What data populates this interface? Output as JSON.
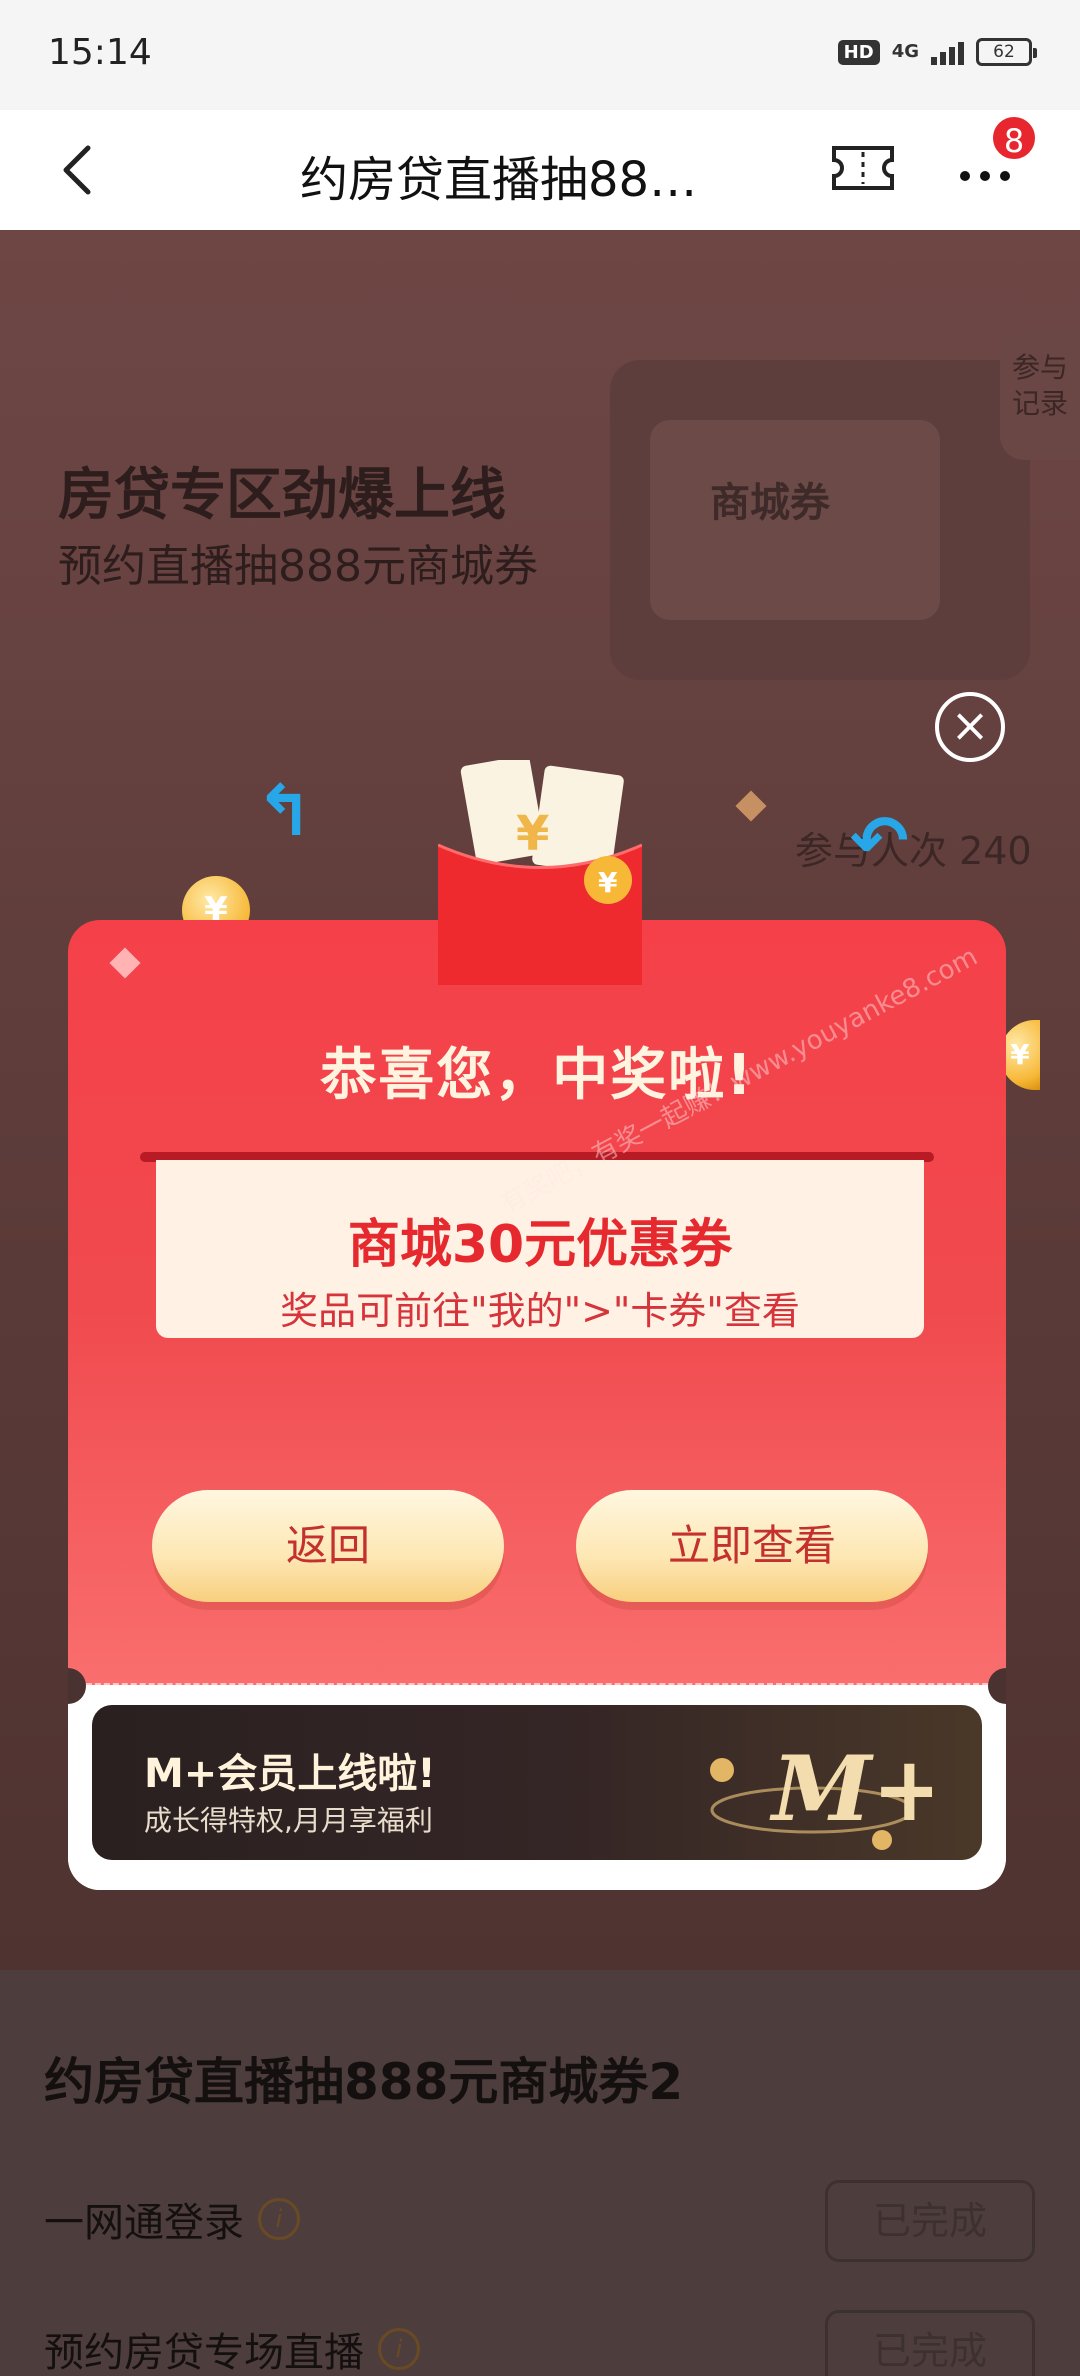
{
  "status_bar": {
    "time": "15:14",
    "hd": "HD",
    "network": "4G",
    "battery": "62"
  },
  "navbar": {
    "title": "约房贷直播抽88…",
    "more_badge": "8"
  },
  "banner": {
    "title": "房贷专区劲爆上线",
    "subtitle": "预约直播抽888元商城券",
    "record_label_1": "参与",
    "record_label_2": "记录",
    "participants": "参与人次 240",
    "voucher_text": "商城券"
  },
  "modal": {
    "title": "恭喜您，中奖啦!",
    "prize_name": "商城30元优惠券",
    "prize_tip": "奖品可前往\"我的\">\"卡券\"查看",
    "back_button": "返回",
    "view_button": "立即查看",
    "close_symbol": "×"
  },
  "vip": {
    "title": "M+会员上线啦!",
    "subtitle": "成长得特权,月月享福利",
    "logo_text": "M+"
  },
  "watermark": "有奖吧，有奖一起赚！www.youyanke8.com",
  "tasks": {
    "page_title": "约房贷直播抽888元商城券2",
    "items": [
      {
        "label": "一网通登录",
        "button": "已完成"
      },
      {
        "label": "预约房贷专场直播",
        "button": "已完成"
      }
    ]
  },
  "colors": {
    "accent_red": "#f04a4e",
    "button_gold": "#fde7b4",
    "badge_red": "#e8262d"
  },
  "icons": [
    "back-arrow-icon",
    "ticket-icon",
    "more-icon",
    "close-icon",
    "info-icon",
    "coin-icon",
    "red-packet-icon"
  ]
}
